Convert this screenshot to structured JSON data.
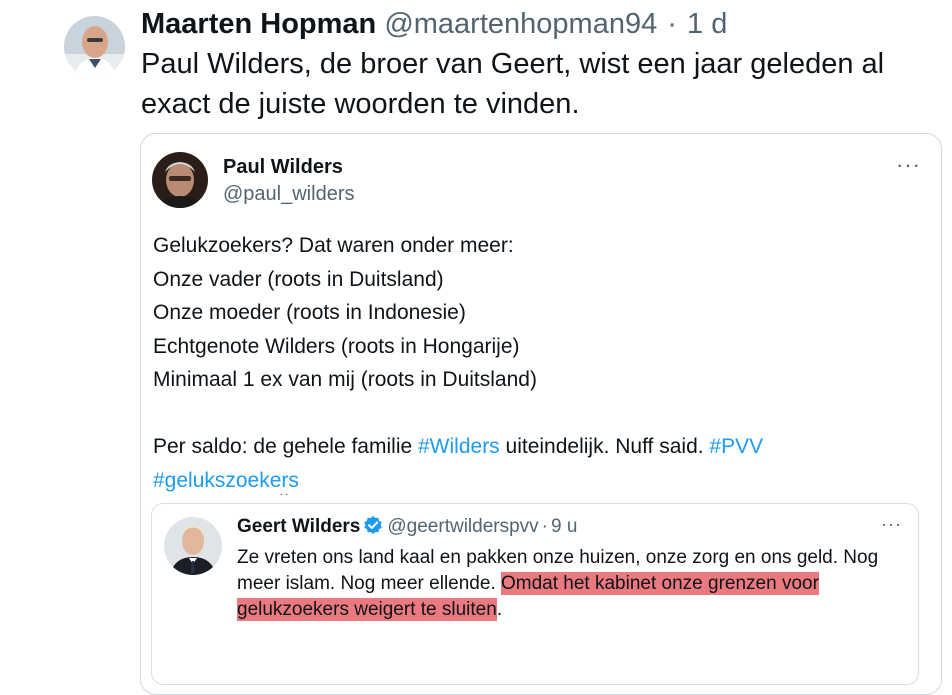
{
  "outer_tweet": {
    "author_name": "Maarten Hopman",
    "handle": "@maartenhopman94",
    "separator": "·",
    "time": "1 d",
    "text_lines": [
      "Paul Wilders, de broer van Geert, wist een jaar geleden al",
      "exact de juiste woorden te vinden."
    ]
  },
  "quoted_tweet": {
    "author_name": "Paul Wilders",
    "handle": "@paul_wilders",
    "more_icon": "···",
    "lines": [
      "Gelukzoekers? Dat waren onder meer:",
      "Onze vader (roots in Duitsland)",
      "Onze moeder (roots in Indonesie)",
      "Echtgenote Wilders (roots in Hongarije)",
      "Minimaal 1 ex van mij (roots in Duitsland)"
    ],
    "closing": {
      "part1": "Per saldo: de gehele familie ",
      "hashtag1": "#Wilders",
      "part2": " uiteindelijk. Nuff said. ",
      "hashtag2": "#PVV",
      "hashtag3": "#gelukszoekers"
    },
    "embedded_screenshot": {
      "author_name": "Geert Wilders",
      "handle": "@geertwilderspvv",
      "separator": "·",
      "time": "9 u",
      "more_icon": "···",
      "line1": "Ze vreten ons land kaal en pakken onze huizen, onze zorg en ons geld. Nog",
      "line2_plain": "meer islam. Nog meer ellende. ",
      "line2_highlight": "Omdat het kabinet onze grenzen voor",
      "line3_highlight": "gelukzoekers weigert te sluiten",
      "line3_end": "."
    }
  },
  "colors": {
    "link_blue": "#1d9bf0",
    "secondary_text": "#536471",
    "highlight": "#ea7a7f",
    "verified_badge": "#1d9bf0"
  }
}
